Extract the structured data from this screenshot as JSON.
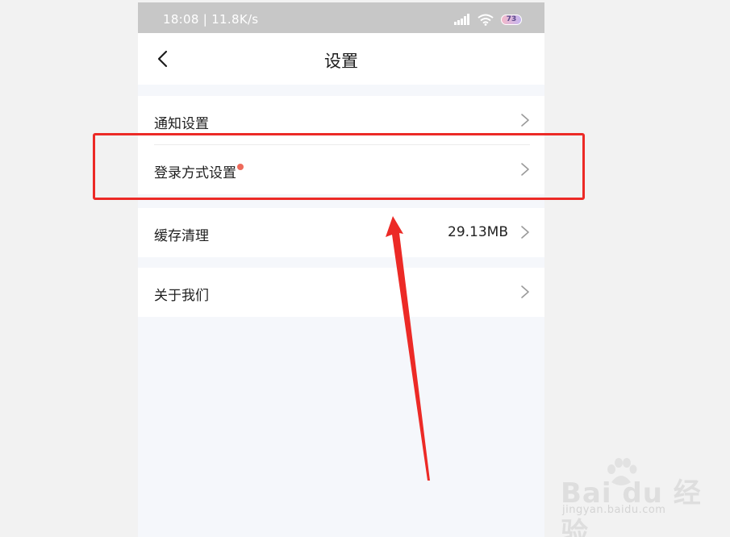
{
  "status_bar": {
    "time_speed": "18:08 | 11.8K/s",
    "battery_level": "73"
  },
  "header": {
    "title": "设置"
  },
  "settings": {
    "groups": [
      {
        "items": [
          {
            "label": "通知设置"
          },
          {
            "label": "登录方式设置",
            "badge": "dot"
          }
        ]
      },
      {
        "items": [
          {
            "label": "缓存清理",
            "value": "29.13MB"
          }
        ]
      },
      {
        "items": [
          {
            "label": "关于我们"
          }
        ]
      }
    ]
  },
  "annotation": {
    "box_color": "#ec2a26",
    "arrow_color": "#ec2a26"
  },
  "watermark": {
    "logo_text": "Bai du 经验",
    "url": "jingyan.baidu.com"
  },
  "icons": [
    "back-arrow-icon",
    "signal-icon",
    "wifi-icon",
    "battery-icon",
    "chevron-right-icon",
    "notification-dot-icon",
    "baidu-paw-icon"
  ]
}
